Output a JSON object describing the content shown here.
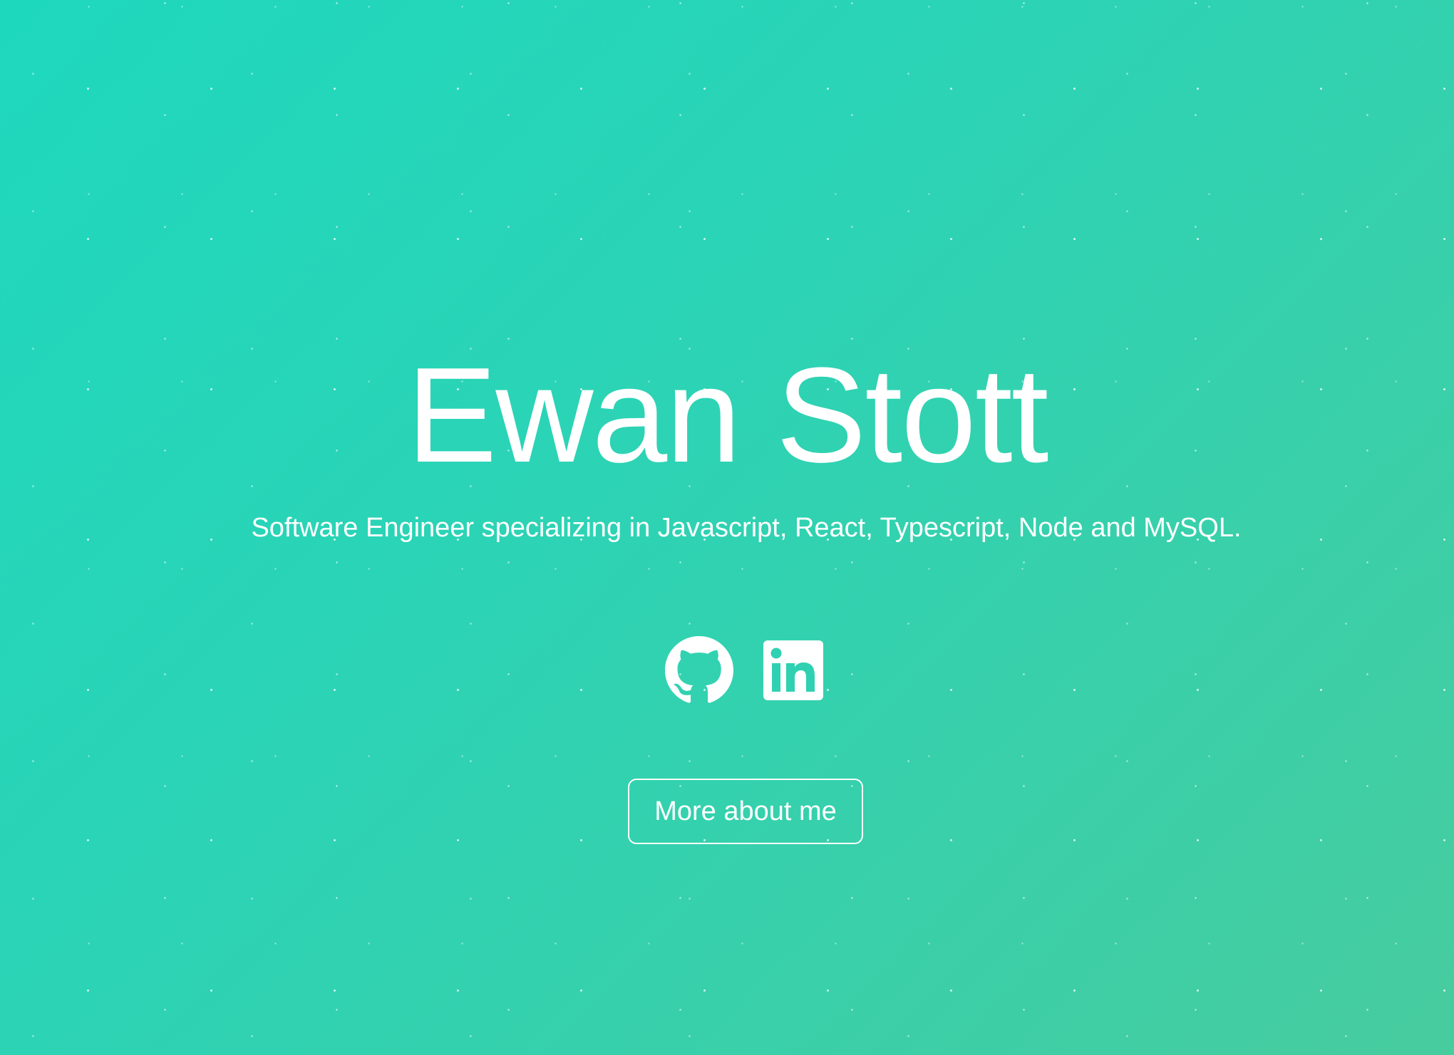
{
  "hero": {
    "name": "Ewan Stott",
    "tagline": "Software Engineer specializing in Javascript, React, Typescript, Node and MySQL.",
    "social": [
      {
        "name": "github",
        "icon": "github-icon"
      },
      {
        "name": "linkedin",
        "icon": "linkedin-icon"
      }
    ],
    "cta_label": "More about me"
  },
  "colors": {
    "gradient_start": "#1ed8be",
    "gradient_end": "#47cc9e",
    "text": "#ffffff"
  }
}
